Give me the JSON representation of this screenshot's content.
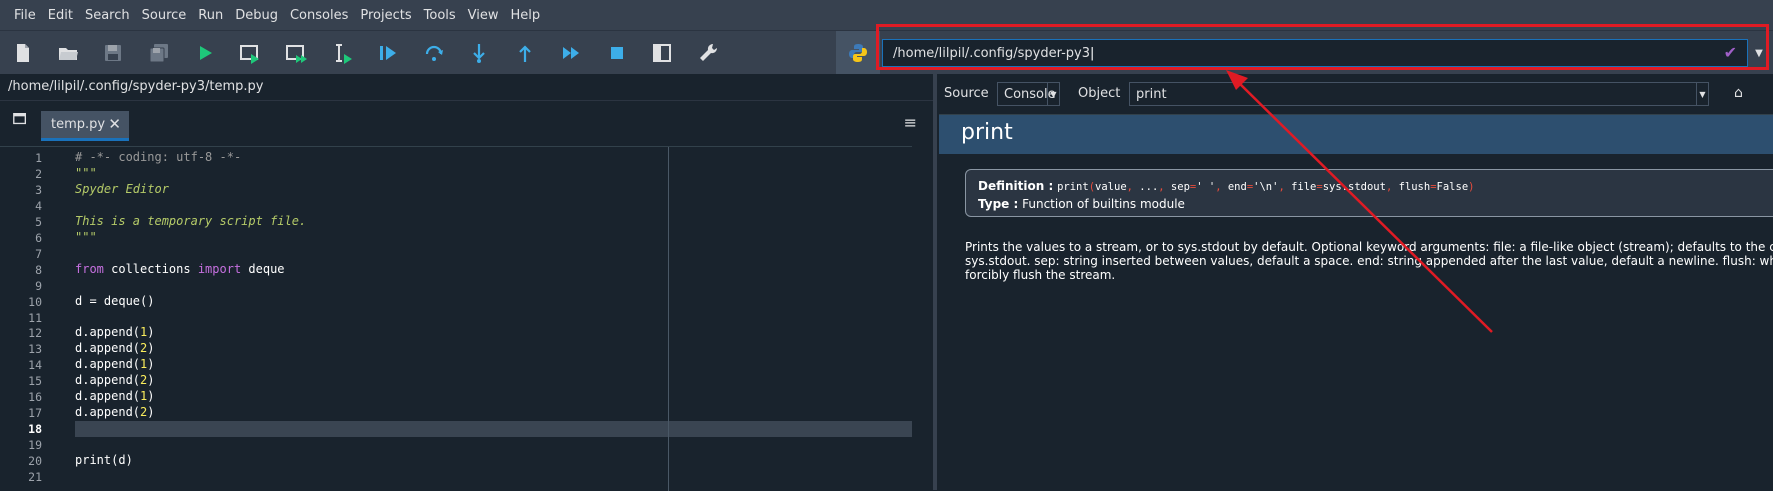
{
  "menu": [
    {
      "label": "File"
    },
    {
      "label": "Edit"
    },
    {
      "label": "Search"
    },
    {
      "label": "Source"
    },
    {
      "label": "Run"
    },
    {
      "label": "Debug"
    },
    {
      "label": "Consoles"
    },
    {
      "label": "Projects"
    },
    {
      "label": "Tools"
    },
    {
      "label": "View"
    },
    {
      "label": "Help"
    }
  ],
  "toolbar": {
    "icons": [
      "new-file-icon",
      "open-folder-icon",
      "save-icon",
      "save-all-icon",
      "run-icon",
      "run-cell-icon",
      "run-cell-advance-icon",
      "run-selection-icon",
      "debug-icon",
      "step-over-icon",
      "step-into-icon",
      "step-return-icon",
      "continue-icon",
      "stop-icon",
      "maximize-pane-icon",
      "preferences-icon",
      "python-path-icon"
    ],
    "working_directory": "/home/lilpil/.config/spyder-py3"
  },
  "editor": {
    "file_path": "/home/lilpil/.config/spyder-py3/temp.py",
    "tab_label": "temp.py",
    "current_line": 18,
    "lines": [
      {
        "n": "1",
        "text": "# -*- coding: utf-8 -*-"
      },
      {
        "n": "2",
        "text": "\"\"\""
      },
      {
        "n": "3",
        "text": "Spyder Editor"
      },
      {
        "n": "4",
        "text": ""
      },
      {
        "n": "5",
        "text": "This is a temporary script file."
      },
      {
        "n": "6",
        "text": "\"\"\""
      },
      {
        "n": "7",
        "text": ""
      },
      {
        "n": "8",
        "text": "from collections import deque"
      },
      {
        "n": "9",
        "text": ""
      },
      {
        "n": "10",
        "text": "d = deque()"
      },
      {
        "n": "11",
        "text": ""
      },
      {
        "n": "12",
        "text": "d.append(1)"
      },
      {
        "n": "13",
        "text": "d.append(2)"
      },
      {
        "n": "14",
        "text": "d.append(1)"
      },
      {
        "n": "15",
        "text": "d.append(2)"
      },
      {
        "n": "16",
        "text": "d.append(1)"
      },
      {
        "n": "17",
        "text": "d.append(2)"
      },
      {
        "n": "18",
        "text": ""
      },
      {
        "n": "19",
        "text": ""
      },
      {
        "n": "20",
        "text": "print(d)"
      },
      {
        "n": "21",
        "text": ""
      }
    ]
  },
  "help": {
    "source_label": "Source",
    "source_value": "Console",
    "object_label": "Object",
    "object_value": "print",
    "title": "print",
    "definition_label": "Definition :",
    "definition_sig": {
      "name": "print",
      "parts": [
        "(",
        "value",
        ", ",
        "...",
        ", ",
        "sep",
        "=",
        "' '",
        ", ",
        "end",
        "=",
        "'\\n'",
        ", ",
        "file",
        "=",
        "sys.stdout",
        ", ",
        "flush",
        "=",
        "False",
        ")"
      ]
    },
    "type_label": "Type :",
    "type_value": "Function of builtins module",
    "body_lines": [
      "Prints the values to a stream, or to sys.stdout by default. Optional keyword arguments: file: a file-like object (stream); defaults to the current",
      "sys.stdout. sep: string inserted between values, default a space. end: string appended after the last value, default a newline. flush: whether to",
      "forcibly flush the stream."
    ]
  },
  "colors": {
    "background": "#19232d",
    "toolbar": "#37414f",
    "accent": "#1a72bb",
    "annotation_red": "#e01b24",
    "run_green": "#00ff00",
    "debug_blue": "#3daee9"
  }
}
